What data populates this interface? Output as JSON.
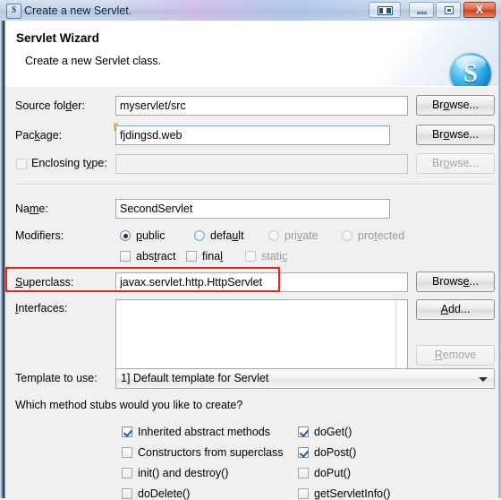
{
  "window": {
    "title": "Create a new Servlet.",
    "icon": "servlet-window-icon",
    "buttons": {
      "help": "help-button",
      "minimize": "minimize-button",
      "maximize": "maximize-button",
      "close": "X"
    }
  },
  "header": {
    "title": "Servlet Wizard",
    "subtitle": "Create a new Servlet class.",
    "logo_letter": "S"
  },
  "form": {
    "source_folder": {
      "label_pre": "Source fol",
      "label_mnemonic": "d",
      "label_post": "er:",
      "value": "myservlet/src",
      "browse": "Browse..."
    },
    "package": {
      "label_pre": "Pac",
      "label_mnemonic": "k",
      "label_post": "age:",
      "value": "fjdingsd.web",
      "browse": "Browse...",
      "focused": true
    },
    "enclosing_type": {
      "label_pre": "Enclosing t",
      "label_mnemonic": "y",
      "label_post": "pe:",
      "value": "",
      "browse": "Browse...",
      "checked": false,
      "enabled": false
    },
    "name": {
      "label_pre": "Na",
      "label_mnemonic": "m",
      "label_post": "e:",
      "value": "SecondServlet"
    },
    "modifiers": {
      "label": "Modifiers:",
      "options": [
        {
          "label_pre": "",
          "label_mnemonic": "p",
          "label_post": "ublic",
          "type": "radio",
          "selected": true,
          "enabled": true
        },
        {
          "label_pre": "defa",
          "label_mnemonic": "u",
          "label_post": "lt",
          "type": "radio",
          "selected": false,
          "enabled": true
        },
        {
          "label_pre": "pri",
          "label_mnemonic": "v",
          "label_post": "ate",
          "type": "radio",
          "selected": false,
          "enabled": false
        },
        {
          "label_pre": "pro",
          "label_mnemonic": "t",
          "label_post": "ected",
          "type": "radio",
          "selected": false,
          "enabled": false
        },
        {
          "label_pre": "abs",
          "label_mnemonic": "t",
          "label_post": "ract",
          "type": "checkbox",
          "selected": false,
          "enabled": true
        },
        {
          "label_pre": "fina",
          "label_mnemonic": "l",
          "label_post": "",
          "type": "checkbox",
          "selected": false,
          "enabled": true
        },
        {
          "label_pre": "stati",
          "label_mnemonic": "c",
          "label_post": "",
          "type": "checkbox",
          "selected": false,
          "enabled": false
        }
      ]
    },
    "superclass": {
      "label_pre": "",
      "label_mnemonic": "S",
      "label_post": "uperclass:",
      "value": "javax.servlet.http.HttpServlet",
      "browse": "Browse...",
      "highlight_color": "#f21f1f"
    },
    "interfaces": {
      "label_pre": "",
      "label_mnemonic": "I",
      "label_post": "nterfaces:",
      "items": [],
      "add_pre": "",
      "add_mnemonic": "A",
      "add_post": "dd...",
      "remove_pre": "",
      "remove_mnemonic": "R",
      "remove_post": "emove",
      "remove_enabled": false
    },
    "template": {
      "label": "Template to use:",
      "value": "1] Default template for Servlet"
    },
    "stubs": {
      "question": "Which method stubs would you like to create?",
      "left": [
        {
          "label": "Inherited abstract methods",
          "checked": true
        },
        {
          "label": "Constructors from superclass",
          "checked": false
        },
        {
          "label": "init() and destroy()",
          "checked": false
        },
        {
          "label": "doDelete()",
          "checked": false
        }
      ],
      "right": [
        {
          "label": "doGet()",
          "checked": true
        },
        {
          "label": "doPost()",
          "checked": true
        },
        {
          "label": "doPut()",
          "checked": false
        },
        {
          "label": "getServletInfo()",
          "checked": false
        }
      ]
    }
  }
}
